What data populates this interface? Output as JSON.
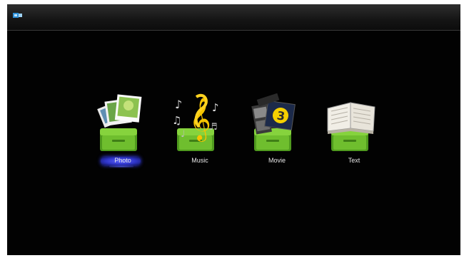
{
  "status_bar": {
    "device_icon": "usb-drive-icon"
  },
  "menu": {
    "selected_index": 0,
    "items": [
      {
        "label": "Photo",
        "icon": "photo-icon"
      },
      {
        "label": "Music",
        "icon": "music-icon"
      },
      {
        "label": "Movie",
        "icon": "movie-icon"
      },
      {
        "label": "Text",
        "icon": "text-icon"
      }
    ]
  },
  "colors": {
    "background": "#020202",
    "tray_green": "#6fbe2e",
    "selection_blue": "#3a43ff",
    "label_text": "#e6e6e6"
  }
}
